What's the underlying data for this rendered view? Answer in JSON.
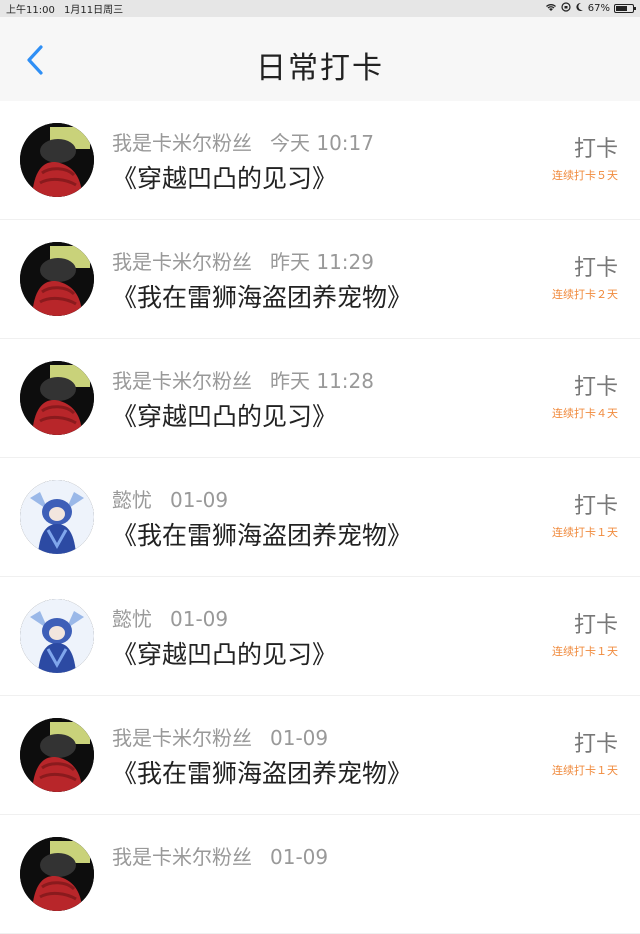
{
  "status_bar": {
    "time": "上午11:00",
    "date": "1月11日周三",
    "battery": "67%"
  },
  "header": {
    "title": "日常打卡",
    "back_icon": "chevron-left-icon"
  },
  "colors": {
    "accent_blue": "#2f8ff5",
    "streak_orange": "#f08a3c"
  },
  "entries": [
    {
      "user": "我是卡米尔粉丝",
      "time": "今天 10:17",
      "book": "《穿越凹凸的见习》",
      "button": "打卡",
      "streak": "连续打卡５天",
      "avatar": "red-scarf"
    },
    {
      "user": "我是卡米尔粉丝",
      "time": "昨天 11:29",
      "book": "《我在雷狮海盗团养宠物》",
      "button": "打卡",
      "streak": "连续打卡２天",
      "avatar": "red-scarf"
    },
    {
      "user": "我是卡米尔粉丝",
      "time": "昨天 11:28",
      "book": "《穿越凹凸的见习》",
      "button": "打卡",
      "streak": "连续打卡４天",
      "avatar": "red-scarf"
    },
    {
      "user": "懿忧",
      "time": "01-09",
      "book": "《我在雷狮海盗团养宠物》",
      "button": "打卡",
      "streak": "连续打卡１天",
      "avatar": "blue-character"
    },
    {
      "user": "懿忧",
      "time": "01-09",
      "book": "《穿越凹凸的见习》",
      "button": "打卡",
      "streak": "连续打卡１天",
      "avatar": "blue-character"
    },
    {
      "user": "我是卡米尔粉丝",
      "time": "01-09",
      "book": "《我在雷狮海盗团养宠物》",
      "button": "打卡",
      "streak": "连续打卡１天",
      "avatar": "red-scarf"
    },
    {
      "user": "我是卡米尔粉丝",
      "time": "01-09",
      "book": "",
      "button": "",
      "streak": "",
      "avatar": "red-scarf"
    }
  ]
}
